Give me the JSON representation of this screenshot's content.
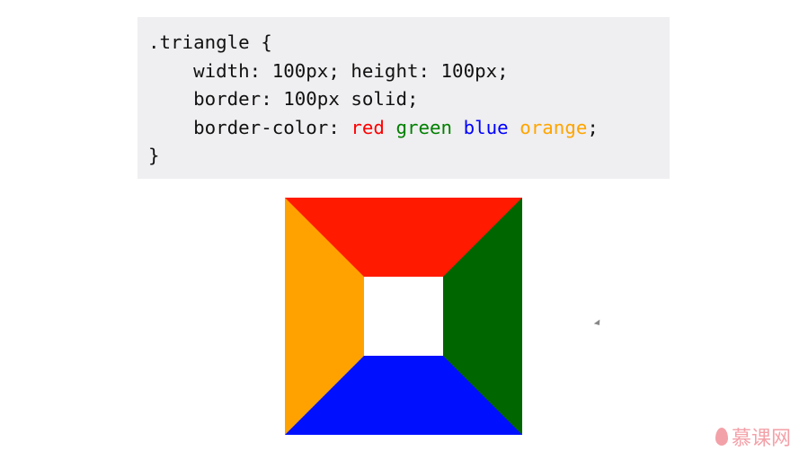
{
  "code": {
    "line1": ".triangle {",
    "line2": "    width: 100px; height: 100px;",
    "line3": "    border: 100px solid;",
    "line4_prefix": "    border-color: ",
    "colors": [
      {
        "name": "red",
        "hex": "#ff0000"
      },
      {
        "name": "green",
        "hex": "#008000"
      },
      {
        "name": "blue",
        "hex": "#0000ff"
      },
      {
        "name": "orange",
        "hex": "#ffa500"
      }
    ],
    "line4_suffix": ";",
    "line5": "}"
  },
  "demo": {
    "border_colors": [
      "#ff1a00",
      "#006600",
      "#0010ff",
      "#ffa200"
    ]
  },
  "watermark": {
    "text": "慕课网"
  }
}
